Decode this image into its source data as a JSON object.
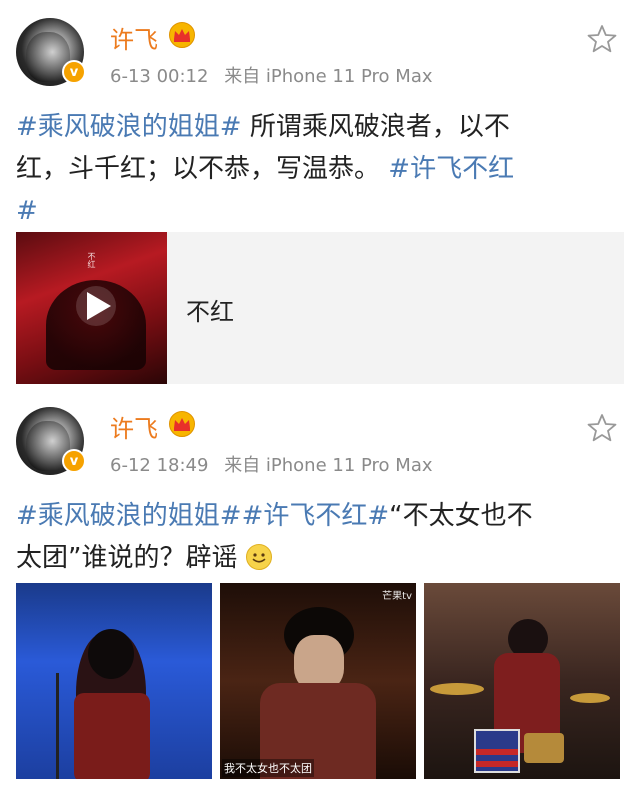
{
  "posts": [
    {
      "username": "许飞",
      "time": "6-13 00:12",
      "source": "来自 iPhone 11 Pro Max",
      "verified_badge": "v",
      "text": {
        "tag1": "#乘风破浪的姐姐#",
        "body_line1": " 所谓乘风破浪者，以不",
        "body_line2": "红，斗千红；以不恭，写温恭。",
        "tag2_part1": "#许飞不红",
        "tag2_part2": "#"
      },
      "video": {
        "title": "不红",
        "thumb_text": "不红"
      }
    },
    {
      "username": "许飞",
      "time": "6-12 18:49",
      "source": "来自 iPhone 11 Pro Max",
      "verified_badge": "v",
      "text": {
        "tags": "#乘风破浪的姐姐##许飞不红#",
        "quote_part1": "“不太女也不",
        "line2": "太团”谁说的？辟谣"
      },
      "photos": [
        {
          "caption": ""
        },
        {
          "caption": "我不太女也不太团",
          "logo": "芒果tv"
        },
        {
          "caption": ""
        }
      ]
    }
  ],
  "colors": {
    "username": "#ec7b1e",
    "hashtag": "#4a7ab3",
    "meta": "#8a8a8a",
    "badge": "#f6a200"
  },
  "icons": [
    "avatar",
    "verified-badge-icon",
    "crown-icon",
    "star-icon",
    "play-icon",
    "smile-emoji-icon"
  ]
}
